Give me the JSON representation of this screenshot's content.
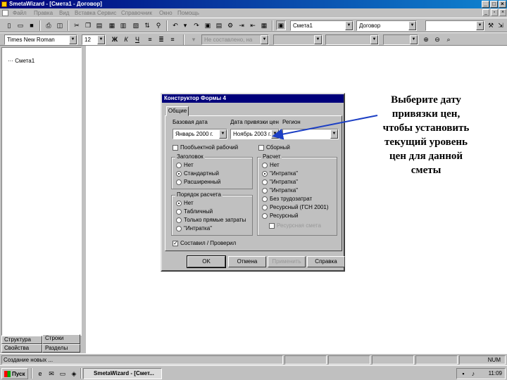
{
  "window": {
    "title": "SmetaWizard - [Смета1 - Договор]"
  },
  "menu": {
    "items": [
      "Файл",
      "Правка",
      "Вид",
      "Вставка",
      "Сервис",
      "Справочник",
      "Окно",
      "Помощь"
    ]
  },
  "toolbar1": {
    "doc_combo": "Смета1",
    "template_combo": "Договор"
  },
  "toolbar2": {
    "font_combo": "Times New Roman",
    "size_combo": "12",
    "bold": "Ж",
    "italic": "К",
    "underline": "Ч",
    "style_combo": "Не составлено, на"
  },
  "tree": {
    "root": "Смета1"
  },
  "left_tabs": [
    "Структура",
    "Строки",
    "Свойства",
    "Разделы"
  ],
  "dialog": {
    "title": "Конструктор Формы 4",
    "tab": "Общие",
    "base_label": "Базовая дата",
    "binding_label": "Дата привязки цен",
    "region_label": "Регион",
    "base_date": "Январь 2000 г.",
    "binding_date": "Ноябрь 2003 г.",
    "region_value": "",
    "check_quantity": "Пообъектной рабочий",
    "check_composite": "Сборный",
    "header_group": {
      "legend": "Заголовок",
      "options": [
        "Нет",
        "Стандартный",
        "Расширенный"
      ],
      "selected": 1
    },
    "markup_group": {
      "legend": "Порядок расчета",
      "options": [
        "Нет",
        "Табличный",
        "Только прямые затраты",
        "\"Интратка\""
      ],
      "selected": 0
    },
    "calc_group": {
      "legend": "Расчет",
      "options": [
        "Нет",
        "\"Интратка\"",
        "\"Интратка\"",
        "\"Интратка\"",
        "Без трудозатрат",
        "Ресурсный (ГСН 2001)",
        "Ресурсный"
      ],
      "selected": 1,
      "sub_check": "Ресурсная смета"
    },
    "check_verify": "Составил / Проверил",
    "buttons": {
      "ok": "OK",
      "cancel": "Отмена",
      "apply": "Применить",
      "help": "Справка"
    }
  },
  "callout": {
    "text_lines": [
      "Выберите дату",
      "привязки цен,",
      "чтобы установить",
      "текущий уровень",
      "цен для данной",
      "сметы"
    ]
  },
  "statusbar": {
    "text": "Создание новых ...",
    "indicator": "NUM"
  },
  "taskbar": {
    "start": "Пуск",
    "task": "SmetaWizard - [Смет...",
    "clock": "11:09"
  },
  "colors": {
    "title_bar": "#00007b",
    "face": "#c0c0c0",
    "arrow": "#1c3fc4"
  }
}
